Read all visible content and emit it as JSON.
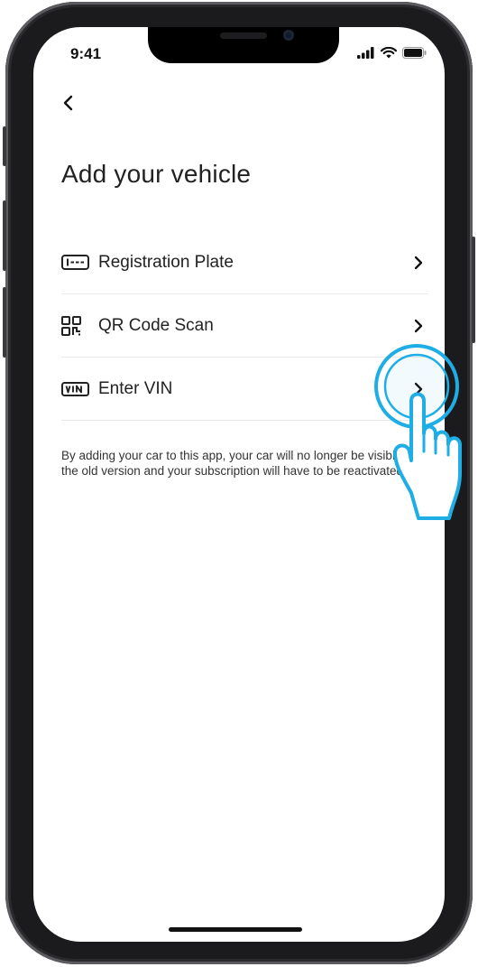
{
  "status_bar": {
    "time": "9:41",
    "icons": [
      "signal-icon",
      "wifi-icon",
      "battery-icon"
    ]
  },
  "nav": {
    "back_icon": "chevron-left-icon"
  },
  "page": {
    "title": "Add your vehicle"
  },
  "options": [
    {
      "label": "Registration Plate",
      "icon": "registration-plate-icon"
    },
    {
      "label": "QR Code Scan",
      "icon": "qr-code-icon"
    },
    {
      "label": "Enter VIN",
      "icon": "vin-icon"
    }
  ],
  "disclaimer": "By adding your car to this app, your car will no longer be visible in the old version and your subscription will have to be reactivated.",
  "colors": {
    "tap_highlight": "#1eaee5",
    "text": "#222222",
    "divider": "#e9e9e9"
  }
}
